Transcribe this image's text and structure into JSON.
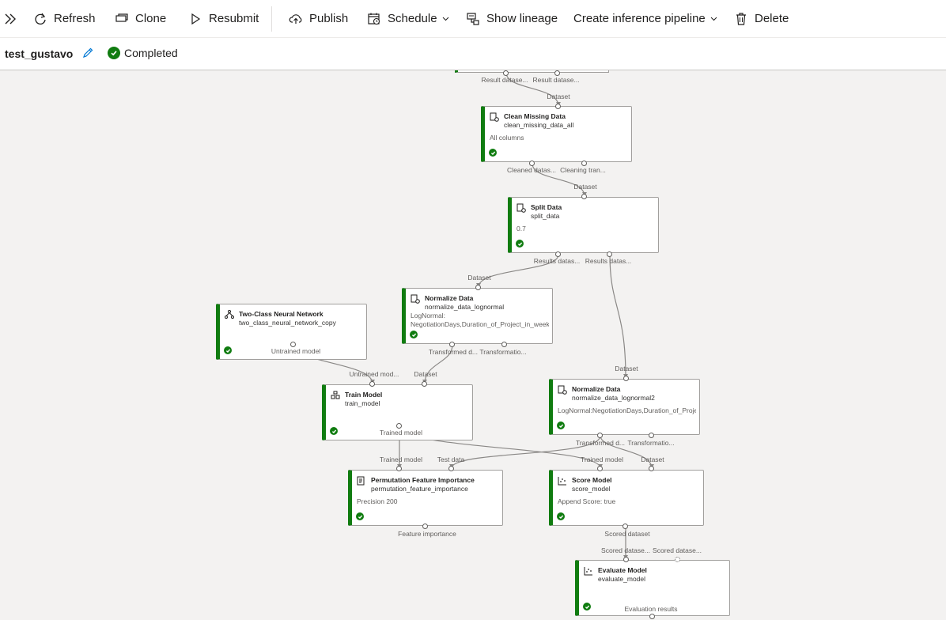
{
  "toolbar": {
    "expand_icon": "double-chevron-right-icon",
    "refresh": "Refresh",
    "clone": "Clone",
    "resubmit": "Resubmit",
    "publish": "Publish",
    "schedule": "Schedule",
    "show_lineage": "Show lineage",
    "create_inference_pipeline": "Create inference pipeline",
    "delete": "Delete"
  },
  "run": {
    "name": "test_gustavo",
    "status": "Completed",
    "status_color": "#107c10"
  },
  "nodes": {
    "clean": {
      "title": "Clean Missing Data",
      "sub": "clean_missing_data_all",
      "param": "All columns",
      "in": [
        "Dataset"
      ],
      "out": [
        "Cleaned datas...",
        "Cleaning tran..."
      ]
    },
    "split": {
      "title": "Split Data",
      "sub": "split_data",
      "param": "0.7",
      "in": [
        "Dataset"
      ],
      "out": [
        "Results datas...",
        "Results datas..."
      ]
    },
    "nn": {
      "title": "Two-Class Neural Network",
      "sub": "two_class_neural_network_copy",
      "param": "",
      "out": [
        "Untrained model"
      ]
    },
    "norm1": {
      "title": "Normalize Data",
      "sub": "normalize_data_lognormal",
      "param": "LogNormal: NegotiationDays,Duration_of_Project_in_weeks,...",
      "in": [
        "Dataset"
      ],
      "out": [
        "Transformed d...",
        "Transformatio..."
      ]
    },
    "train": {
      "title": "Train Model",
      "sub": "train_model",
      "param": "",
      "in": [
        "Untrained mod...",
        "Dataset"
      ],
      "out": [
        "Trained model"
      ]
    },
    "norm2": {
      "title": "Normalize Data",
      "sub": "normalize_data_lognormal2",
      "param": "LogNormal:NegotiationDays,Duration_of_Project_in_weeks",
      "in": [
        "Dataset"
      ],
      "out": [
        "Transformed d...",
        "Transformatio..."
      ]
    },
    "pfi": {
      "title": "Permutation Feature Importance",
      "sub": "permutation_feature_importance",
      "param": "Precision 200",
      "in": [
        "Trained model",
        "Test data"
      ],
      "out": [
        "Feature importance"
      ]
    },
    "score": {
      "title": "Score Model",
      "sub": "score_model",
      "param": "Append Score: true",
      "in": [
        "Trained model",
        "Dataset"
      ],
      "out": [
        "Scored dataset"
      ]
    },
    "eval": {
      "title": "Evaluate Model",
      "sub": "evaluate_model",
      "param": "",
      "in": [
        "Scored datase...",
        "Scored datase..."
      ],
      "out": [
        "Evaluation results"
      ]
    },
    "top": {
      "out": [
        "Result datase...",
        "Result datase..."
      ]
    }
  }
}
